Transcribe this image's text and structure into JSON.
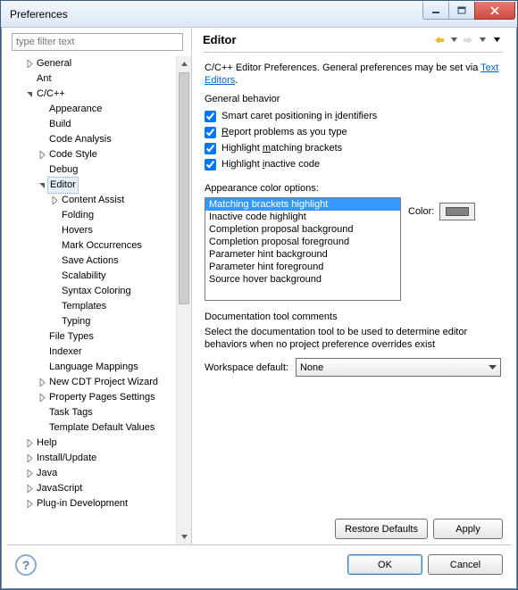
{
  "window": {
    "title": "Preferences"
  },
  "filter": {
    "placeholder": "type filter text"
  },
  "tree": {
    "items": [
      {
        "indent": 1,
        "twisty": "closed",
        "label": "General"
      },
      {
        "indent": 1,
        "twisty": "none",
        "label": "Ant"
      },
      {
        "indent": 1,
        "twisty": "open",
        "label": "C/C++"
      },
      {
        "indent": 2,
        "twisty": "none",
        "label": "Appearance"
      },
      {
        "indent": 2,
        "twisty": "none",
        "label": "Build"
      },
      {
        "indent": 2,
        "twisty": "none",
        "label": "Code Analysis"
      },
      {
        "indent": 2,
        "twisty": "closed",
        "label": "Code Style"
      },
      {
        "indent": 2,
        "twisty": "none",
        "label": "Debug"
      },
      {
        "indent": 2,
        "twisty": "open",
        "label": "Editor",
        "selected": true
      },
      {
        "indent": 3,
        "twisty": "closed",
        "label": "Content Assist"
      },
      {
        "indent": 3,
        "twisty": "none",
        "label": "Folding"
      },
      {
        "indent": 3,
        "twisty": "none",
        "label": "Hovers"
      },
      {
        "indent": 3,
        "twisty": "none",
        "label": "Mark Occurrences"
      },
      {
        "indent": 3,
        "twisty": "none",
        "label": "Save Actions"
      },
      {
        "indent": 3,
        "twisty": "none",
        "label": "Scalability"
      },
      {
        "indent": 3,
        "twisty": "none",
        "label": "Syntax Coloring"
      },
      {
        "indent": 3,
        "twisty": "none",
        "label": "Templates"
      },
      {
        "indent": 3,
        "twisty": "none",
        "label": "Typing"
      },
      {
        "indent": 2,
        "twisty": "none",
        "label": "File Types"
      },
      {
        "indent": 2,
        "twisty": "none",
        "label": "Indexer"
      },
      {
        "indent": 2,
        "twisty": "none",
        "label": "Language Mappings"
      },
      {
        "indent": 2,
        "twisty": "closed",
        "label": "New CDT Project Wizard"
      },
      {
        "indent": 2,
        "twisty": "closed",
        "label": "Property Pages Settings"
      },
      {
        "indent": 2,
        "twisty": "none",
        "label": "Task Tags"
      },
      {
        "indent": 2,
        "twisty": "none",
        "label": "Template Default Values"
      },
      {
        "indent": 1,
        "twisty": "closed",
        "label": "Help"
      },
      {
        "indent": 1,
        "twisty": "closed",
        "label": "Install/Update"
      },
      {
        "indent": 1,
        "twisty": "closed",
        "label": "Java"
      },
      {
        "indent": 1,
        "twisty": "closed",
        "label": "JavaScript"
      },
      {
        "indent": 1,
        "twisty": "closed",
        "label": "Plug-in Development"
      }
    ]
  },
  "page": {
    "title": "Editor",
    "desc_prefix": "C/C++ Editor Preferences. General preferences may be set via ",
    "desc_link": "Text Editors",
    "desc_suffix": ".",
    "general_behavior": "General behavior",
    "checks": {
      "caret_pre": "Smart caret positioning in ",
      "caret_u": "i",
      "caret_post": "dentifiers",
      "report_u": "R",
      "report_post": "eport problems as you type",
      "highlight_pre": "Highlight ",
      "highlight_u": "m",
      "highlight_post": "atching brackets",
      "inactive_pre": "Highlight ",
      "inactive_u": "i",
      "inactive_post": "nactive code"
    },
    "appearance_label": "Appearance color options:",
    "color_options": [
      "Matching brackets highlight",
      "Inactive code highlight",
      "Completion proposal background",
      "Completion proposal foreground",
      "Parameter hint background",
      "Parameter hint foreground",
      "Source hover background"
    ],
    "color_label": "Color:",
    "selected_color": "#808080",
    "doc_title": "Documentation tool comments",
    "doc_desc": "Select the documentation tool to be used to determine editor behaviors when no project preference overrides exist",
    "workspace_default": "Workspace default:",
    "workspace_value": "None",
    "restore": "Restore Defaults",
    "apply": "Apply"
  },
  "footer": {
    "ok": "OK",
    "cancel": "Cancel"
  }
}
